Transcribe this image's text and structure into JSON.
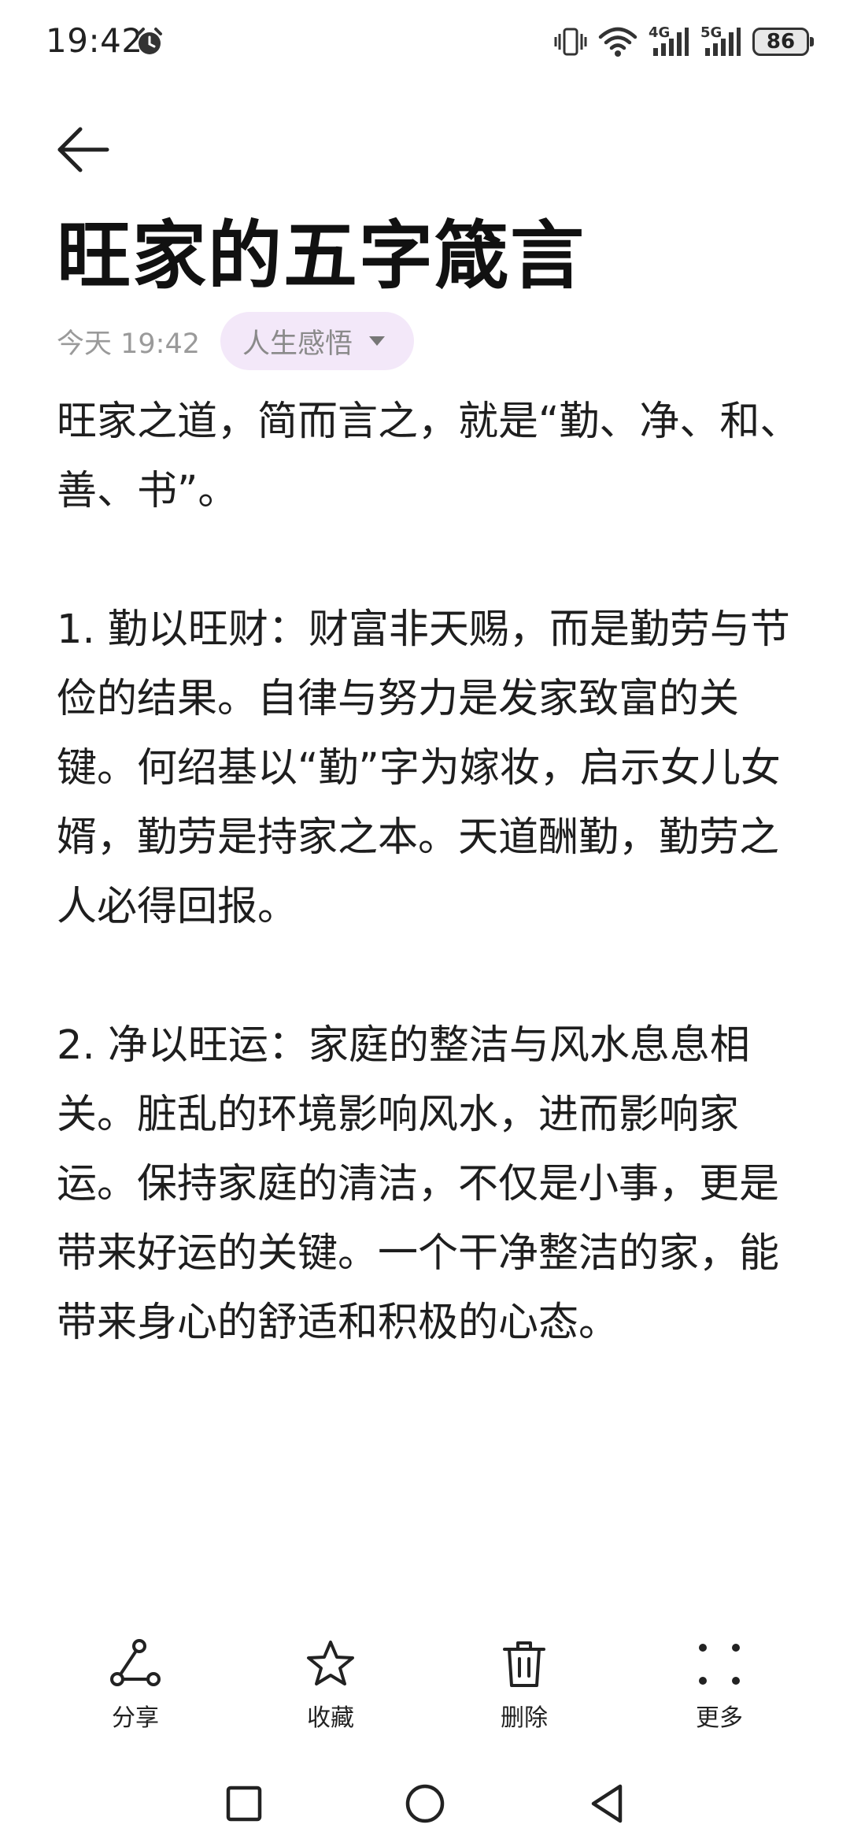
{
  "status_bar": {
    "time": "19:42",
    "network_4g": "4G",
    "network_5g": "5G",
    "battery": "86"
  },
  "note": {
    "title": "旺家的五字箴言",
    "date": "今天 19:42",
    "category": "人生感悟",
    "paragraphs": [
      "旺家之道，简而言之，就是“勤、净、和、善、书”。",
      "1. 勤以旺财：财富非天赐，而是勤劳与节俭的结果。自律与努力是发家致富的关键。何绍基以“勤”字为嫁妆，启示女儿女婿，勤劳是持家之本。天道酬勤，勤劳之人必得回报。",
      "2. 净以旺运：家庭的整洁与风水息息相关。脏乱的环境影响风水，进而影响家运。保持家庭的清洁，不仅是小事，更是带来好运的关键。一个干净整洁的家，能带来身心的舒适和积极的心态。"
    ]
  },
  "toolbar": {
    "share": "分享",
    "favorite": "收藏",
    "delete": "删除",
    "more": "更多"
  },
  "icons": {
    "back": "arrow-left-icon",
    "share": "share-icon",
    "favorite": "star-icon",
    "delete": "trash-icon",
    "more": "more-dots-icon"
  },
  "colors": {
    "chip_bg": "#f3e8f9",
    "muted_text": "#9a9a9a",
    "text": "#1e1e1e"
  }
}
